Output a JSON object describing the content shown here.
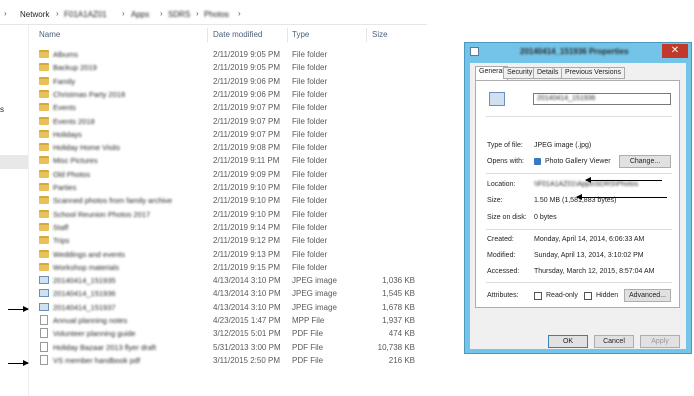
{
  "explorer": {
    "breadcrumb": {
      "network": "Network",
      "server": "F01A1AZ01",
      "share": "Apps",
      "folder1": "SDRS",
      "folder2": "Photos"
    },
    "left_pane_letter": "s",
    "columns": {
      "name": "Name",
      "date": "Date modified",
      "type": "Type",
      "size": "Size"
    },
    "rows": [
      {
        "icon": "folder-icon",
        "name": "Albums",
        "date": "2/11/2019 9:05 PM",
        "type": "File folder",
        "size": ""
      },
      {
        "icon": "folder-icon",
        "name": "Backup 2019",
        "date": "2/11/2019 9:05 PM",
        "type": "File folder",
        "size": ""
      },
      {
        "icon": "folder-icon",
        "name": "Family",
        "date": "2/11/2019 9:06 PM",
        "type": "File folder",
        "size": ""
      },
      {
        "icon": "folder-icon",
        "name": "Christmas Party 2018",
        "date": "2/11/2019 9:06 PM",
        "type": "File folder",
        "size": ""
      },
      {
        "icon": "folder-icon",
        "name": "Events",
        "date": "2/11/2019 9:07 PM",
        "type": "File folder",
        "size": ""
      },
      {
        "icon": "folder-icon",
        "name": "Events 2018",
        "date": "2/11/2019 9:07 PM",
        "type": "File folder",
        "size": ""
      },
      {
        "icon": "folder-icon",
        "name": "Holidays",
        "date": "2/11/2019 9:07 PM",
        "type": "File folder",
        "size": ""
      },
      {
        "icon": "folder-icon",
        "name": "Holiday Home Visits",
        "date": "2/11/2019 9:08 PM",
        "type": "File folder",
        "size": ""
      },
      {
        "icon": "folder-icon",
        "name": "Misc Pictures",
        "date": "2/11/2019 9:11 PM",
        "type": "File folder",
        "size": ""
      },
      {
        "icon": "folder-icon",
        "name": "Old Photos",
        "date": "2/11/2019 9:09 PM",
        "type": "File folder",
        "size": ""
      },
      {
        "icon": "folder-icon",
        "name": "Parties",
        "date": "2/11/2019 9:10 PM",
        "type": "File folder",
        "size": ""
      },
      {
        "icon": "folder-icon",
        "name": "Scanned photos from family archive",
        "date": "2/11/2019 9:10 PM",
        "type": "File folder",
        "size": ""
      },
      {
        "icon": "folder-icon",
        "name": "School Reunion Photos 2017",
        "date": "2/11/2019 9:10 PM",
        "type": "File folder",
        "size": ""
      },
      {
        "icon": "folder-icon",
        "name": "Staff",
        "date": "2/11/2019 9:14 PM",
        "type": "File folder",
        "size": ""
      },
      {
        "icon": "folder-icon",
        "name": "Trips",
        "date": "2/11/2019 9:12 PM",
        "type": "File folder",
        "size": ""
      },
      {
        "icon": "folder-icon",
        "name": "Weddings and events",
        "date": "2/11/2019 9:13 PM",
        "type": "File folder",
        "size": ""
      },
      {
        "icon": "folder-icon",
        "name": "Workshop materials",
        "date": "2/11/2019 9:15 PM",
        "type": "File folder",
        "size": ""
      },
      {
        "icon": "jpeg-icon",
        "name": "20140414_151935",
        "date": "4/13/2014 3:10 PM",
        "type": "JPEG image",
        "size": "1,036 KB"
      },
      {
        "icon": "jpeg-icon",
        "name": "20140414_151936",
        "date": "4/13/2014 3:10 PM",
        "type": "JPEG image",
        "size": "1,545 KB"
      },
      {
        "icon": "jpeg-icon",
        "name": "20140414_151937",
        "date": "4/13/2014 3:10 PM",
        "type": "JPEG image",
        "size": "1,678 KB"
      },
      {
        "icon": "document-icon",
        "name": "Annual planning notes",
        "date": "4/23/2015 1:47 PM",
        "type": "MPP File",
        "size": "1,937 KB"
      },
      {
        "icon": "document-icon",
        "name": "Volunteer planning guide",
        "date": "3/12/2015 5:01 PM",
        "type": "PDF File",
        "size": "474 KB"
      },
      {
        "icon": "document-icon",
        "name": "Holiday Bazaar 2013 flyer draft",
        "date": "5/31/2013 3:00 PM",
        "type": "PDF File",
        "size": "10,738 KB"
      },
      {
        "icon": "document-icon",
        "name": "VS member handbook pdf",
        "date": "3/11/2015 2:50 PM",
        "type": "PDF File",
        "size": "216 KB"
      }
    ]
  },
  "dialog": {
    "title": "20140414_151936 Properties",
    "close_glyph": "✕",
    "tabs": [
      "General",
      "Security",
      "Details",
      "Previous Versions"
    ],
    "file_name": "20140414_151936",
    "type_label": "Type of file:",
    "type_value": "JPEG image (.jpg)",
    "opens_label": "Opens with:",
    "opens_value": "Photo Gallery Viewer",
    "change_button": "Change...",
    "location_label": "Location:",
    "location_value": "\\\\F01A1AZ01\\Apps\\SDRS\\Photos",
    "size_label": "Size:",
    "size_value": "1.50 MB (1,581,883 bytes)",
    "size_disk_label": "Size on disk:",
    "size_disk_value": "0 bytes",
    "created_label": "Created:",
    "created_value": "Monday, April 14, 2014, 6:06:33 AM",
    "modified_label": "Modified:",
    "modified_value": "Sunday, April 13, 2014, 3:10:02 PM",
    "accessed_label": "Accessed:",
    "accessed_value": "Thursday, March 12, 2015, 8:57:04 AM",
    "attributes_label": "Attributes:",
    "readonly_label": "Read-only",
    "hidden_label": "Hidden",
    "advanced_button": "Advanced...",
    "ok_button": "OK",
    "cancel_button": "Cancel",
    "apply_button": "Apply"
  }
}
